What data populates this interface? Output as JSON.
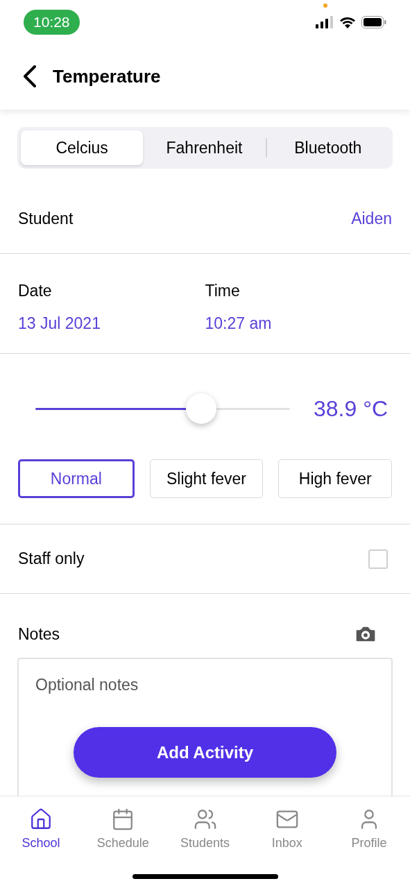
{
  "status_bar": {
    "time": "10:28"
  },
  "header": {
    "title": "Temperature"
  },
  "unit_tabs": [
    {
      "label": "Celcius",
      "selected": true
    },
    {
      "label": "Fahrenheit",
      "selected": false
    },
    {
      "label": "Bluetooth",
      "selected": false
    }
  ],
  "student": {
    "label": "Student",
    "value": "Aiden"
  },
  "date": {
    "label": "Date",
    "value": "13 Jul 2021"
  },
  "time": {
    "label": "Time",
    "value": "10:27 am"
  },
  "temperature": {
    "level": 0.65,
    "reading": "38.9 °C"
  },
  "fever_options": [
    {
      "label": "Normal",
      "selected": true
    },
    {
      "label": "Slight fever",
      "selected": false
    },
    {
      "label": "High fever",
      "selected": false
    }
  ],
  "staff_only": {
    "label": "Staff only",
    "checked": false
  },
  "notes": {
    "label": "Notes",
    "placeholder": "Optional notes"
  },
  "add_button": "Add Activity",
  "tab_bar": [
    {
      "label": "School",
      "selected": true
    },
    {
      "label": "Schedule",
      "selected": false
    },
    {
      "label": "Students",
      "selected": false
    },
    {
      "label": "Inbox",
      "selected": false
    },
    {
      "label": "Profile",
      "selected": false
    }
  ]
}
